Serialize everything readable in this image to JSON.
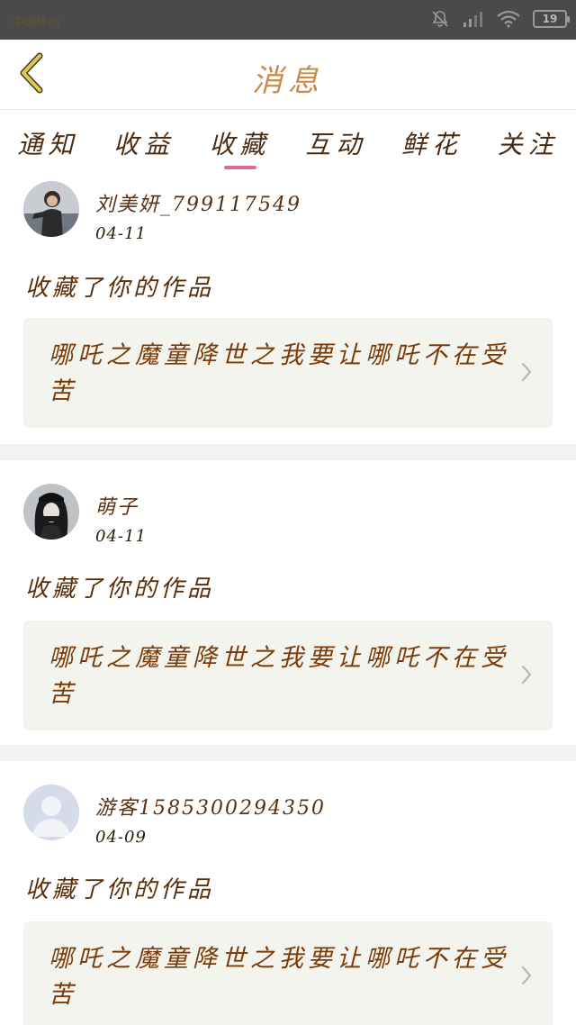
{
  "status_bar": {
    "left_text": "中国移动",
    "battery": "19"
  },
  "header": {
    "title": "消息"
  },
  "tabs": [
    {
      "label": "通知",
      "active": false
    },
    {
      "label": "收益",
      "active": false
    },
    {
      "label": "收藏",
      "active": true
    },
    {
      "label": "互动",
      "active": false
    },
    {
      "label": "鲜花",
      "active": false
    },
    {
      "label": "关注",
      "active": false
    }
  ],
  "feed": [
    {
      "user_name": "刘美妍_799117549",
      "date": "04-11",
      "action": "收藏了你的作品",
      "work_title": "哪吒之魔童降世之我要让哪吒不在受苦",
      "avatar": "photo-avatar"
    },
    {
      "user_name": "萌子",
      "date": "04-11",
      "action": "收藏了你的作品",
      "work_title": "哪吒之魔童降世之我要让哪吒不在受苦",
      "avatar": "photo-avatar"
    },
    {
      "user_name": "游客1585300294350",
      "date": "04-09",
      "action": "收藏了你的作品",
      "work_title": "哪吒之魔童降世之我要让哪吒不在受苦",
      "avatar": "default-avatar"
    }
  ],
  "colors": {
    "accent_underline": "#e0679a",
    "back_icon": "#e6c84a",
    "work_box_bg": "#f4f4ef"
  }
}
